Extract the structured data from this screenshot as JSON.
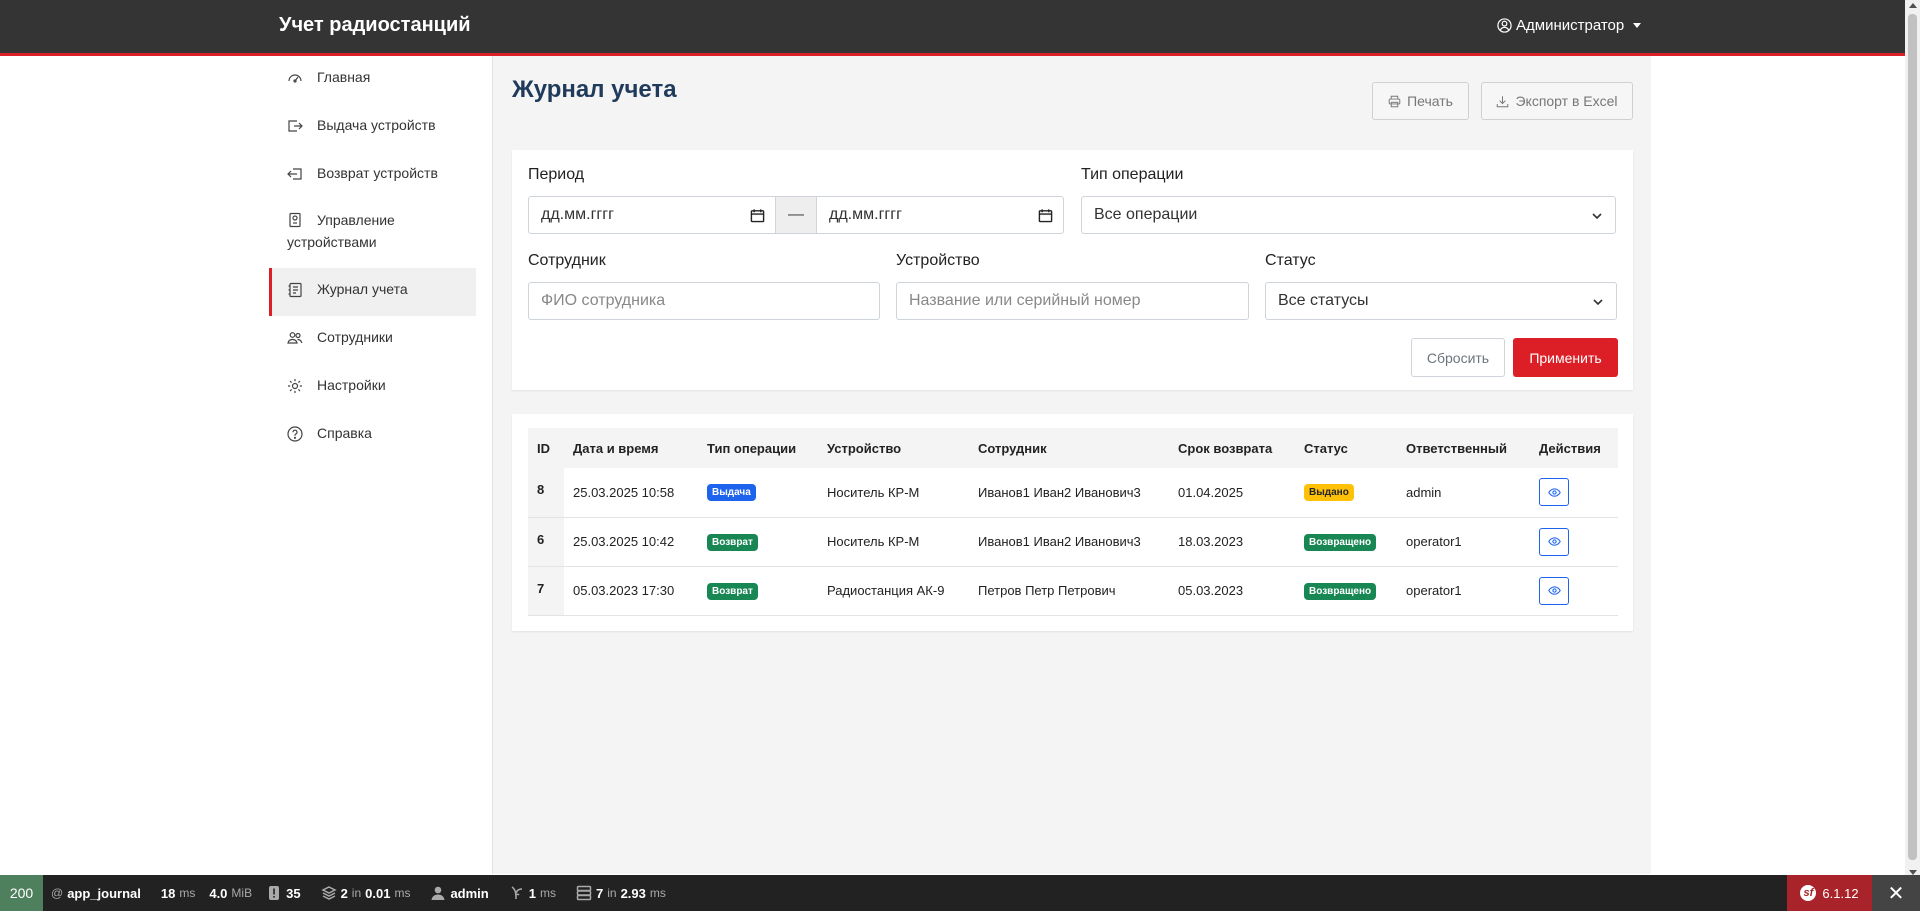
{
  "app": {
    "brand": "Учет радиостанций",
    "user": "Администратор"
  },
  "sidebar": {
    "items": [
      {
        "label": "Главная",
        "icon": "speedometer-icon"
      },
      {
        "label": "Выдача устройств",
        "icon": "box-arrow-right-icon"
      },
      {
        "label": "Возврат устройств",
        "icon": "box-arrow-in-left-icon"
      },
      {
        "label": "Управление устройствами",
        "icon": "device-icon"
      },
      {
        "label": "Журнал учета",
        "icon": "journal-icon",
        "active": true
      },
      {
        "label": "Сотрудники",
        "icon": "people-icon"
      },
      {
        "label": "Настройки",
        "icon": "gear-icon"
      },
      {
        "label": "Справка",
        "icon": "question-circle-icon"
      }
    ]
  },
  "page": {
    "title": "Журнал учета",
    "print_label": "Печать",
    "export_label": "Экспорт в Excel"
  },
  "filters": {
    "period_label": "Период",
    "date_from_placeholder": "дд.мм.гггг",
    "date_separator": "—",
    "date_to_placeholder": "дд.мм.гггг",
    "operation_label": "Тип операции",
    "operation_value": "Все операции",
    "employee_label": "Сотрудник",
    "employee_placeholder": "ФИО сотрудника",
    "device_label": "Устройство",
    "device_placeholder": "Название или серийный номер",
    "status_label": "Статус",
    "status_value": "Все статусы",
    "reset_label": "Сбросить",
    "apply_label": "Применить"
  },
  "table": {
    "headers": [
      "ID",
      "Дата и время",
      "Тип операции",
      "Устройство",
      "Сотрудник",
      "Срок возврата",
      "Статус",
      "Ответственный",
      "Действия"
    ],
    "rows": [
      {
        "id": "8",
        "datetime": "25.03.2025 10:58",
        "operation": "Выдача",
        "operation_color": "#1d63ed",
        "device": "Носитель КР-М",
        "employee": "Иванов1 Иван2 Иванович3",
        "due": "01.04.2025",
        "status": "Выдано",
        "status_color": "#ffc107",
        "responsible": "admin"
      },
      {
        "id": "6",
        "datetime": "25.03.2025 10:42",
        "operation": "Возврат",
        "operation_color": "#198754",
        "device": "Носитель КР-М",
        "employee": "Иванов1 Иван2 Иванович3",
        "due": "18.03.2023",
        "status": "Возвращено",
        "status_color": "#198754",
        "responsible": "operator1"
      },
      {
        "id": "7",
        "datetime": "05.03.2023 17:30",
        "operation": "Возврат",
        "operation_color": "#198754",
        "device": "Радиостанция АК-9",
        "employee": "Петров Петр Петрович",
        "due": "05.03.2023",
        "status": "Возвращено",
        "status_color": "#198754",
        "responsible": "operator1"
      }
    ]
  },
  "debug_toolbar": {
    "status_code": "200",
    "route_prefix": "@",
    "route": "app_journal",
    "time_value": "18",
    "time_unit": "ms",
    "memory_value": "4.0",
    "memory_unit": "MiB",
    "logs": "35",
    "twig_count": "2",
    "twig_in": "in",
    "twig_time": "0.01",
    "twig_unit": "ms",
    "user": "admin",
    "cache_value": "1",
    "cache_unit": "ms",
    "db_count": "7",
    "db_in": "in",
    "db_time": "2.93",
    "db_unit": "ms",
    "version": "6.1.12",
    "sf_logo_letter": "sf",
    "close": "✕"
  },
  "colors": {
    "accent": "#dc1f26",
    "navbar": "#343434",
    "title": "#1f3a5b"
  }
}
